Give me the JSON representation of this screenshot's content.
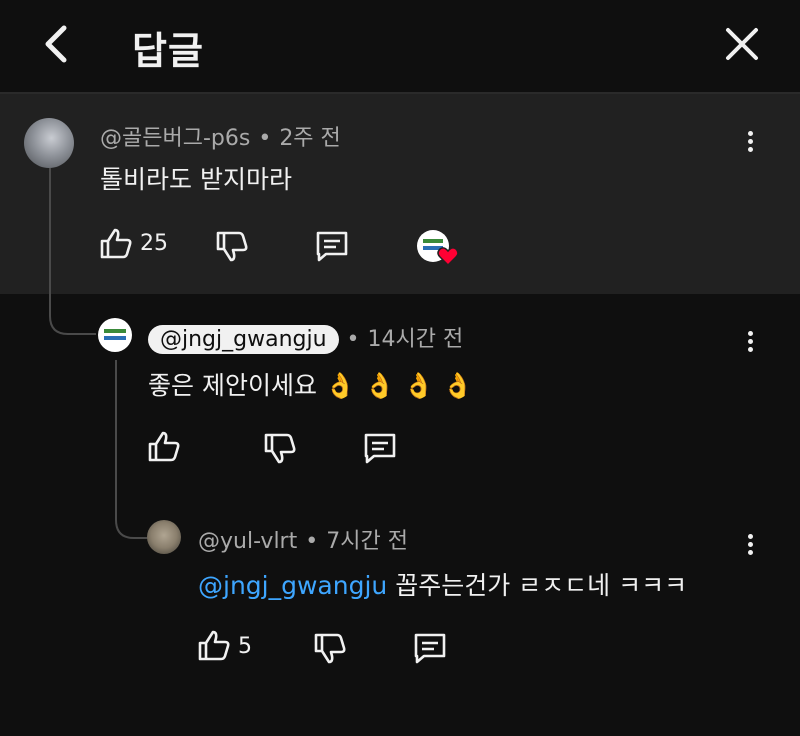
{
  "header": {
    "title": "답글"
  },
  "parent_comment": {
    "author": "@골든버그-p6s",
    "time": "2주 전",
    "text": "톨비라도 받지마라",
    "likes": "25"
  },
  "reply1": {
    "author": "@jngj_gwangju",
    "time": "14시간 전",
    "text": "좋은 제안이세요 👌 👌 👌 👌",
    "likes": ""
  },
  "reply2": {
    "author": "@yul-vlrt",
    "time": "7시간 전",
    "mention": "@jngj_gwangju",
    "text": " 꼽주는건가 ㄹㅈㄷ네 ㅋㅋㅋ",
    "likes": "5"
  },
  "colors": {
    "background": "#0f0f0f",
    "highlight": "#212121",
    "mention": "#3ea6ff",
    "heart": "#ff0033"
  },
  "icons": [
    "back-arrow-icon",
    "close-icon",
    "more-vert-icon",
    "like-icon",
    "dislike-icon",
    "reply-icon",
    "creator-heart-icon"
  ]
}
